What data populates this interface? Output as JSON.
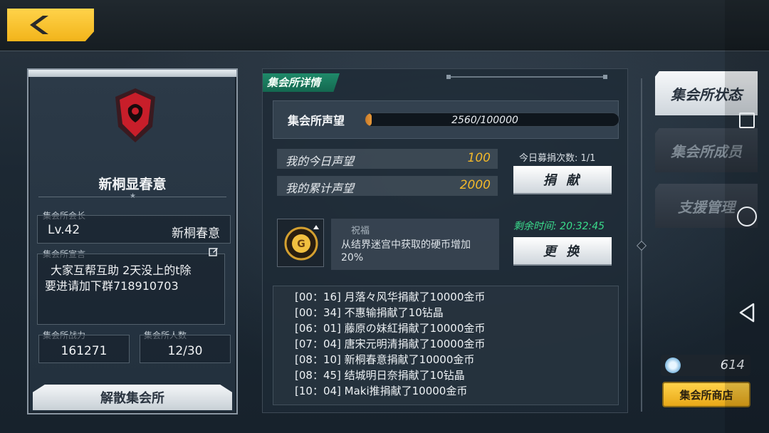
{
  "header": {
    "back_label": ""
  },
  "guild": {
    "name": "新桐显春意",
    "leader_label": "集会所会长",
    "leader_level": "Lv.42",
    "leader_name": "新桐春意",
    "declaration_label": "集会所宣言",
    "declaration_line1": "大家互帮互助 2天没上的t除",
    "declaration_line2": "要进请加下群718910703",
    "power_label": "集会所战力",
    "power_value": "161271",
    "members_label": "集会所人数",
    "members_value": "12/30",
    "disband_label": "解散集会所"
  },
  "details": {
    "tab_label": "集会所详情",
    "reputation_label": "集会所声望",
    "reputation_text": "2560/100000",
    "reputation_current": 2560,
    "reputation_max": 100000,
    "today_label": "我的今日声望",
    "today_value": "100",
    "total_label": "我的累计声望",
    "total_value": "2000",
    "donate_count": "今日募捐次数: 1/1",
    "donate_button": "捐 献",
    "blessing_title": "祝福",
    "blessing_desc": "从结界迷宫中获取的硬币增加20%",
    "timer": "剩余时间: 20:32:45",
    "change_button": "更 换",
    "logs": [
      "[00：16] 月落々风华捐献了10000金币",
      "[00：34] 不惠输捐献了10钻晶",
      "[06：01] 藤原の妹紅捐献了10000金币",
      "[07：04] 唐宋元明清捐献了10000金币",
      "[08：10] 新桐春意捐献了10000金币",
      "[08：45] 结城明日奈捐献了10钻晶",
      "[10：04] Maki推捐献了10000金币"
    ]
  },
  "right_tabs": [
    {
      "label": "集会所状态",
      "active": true
    },
    {
      "label": "集会所成员",
      "active": false
    },
    {
      "label": "支援管理",
      "active": false
    }
  ],
  "currency": {
    "value": "614"
  },
  "shop_button": "集会所商店",
  "colors": {
    "accent_yellow": "#f2b41a",
    "tab_green": "#1f8a6a",
    "timer_green": "#3adc8c",
    "value_gold": "#f2b82a"
  }
}
